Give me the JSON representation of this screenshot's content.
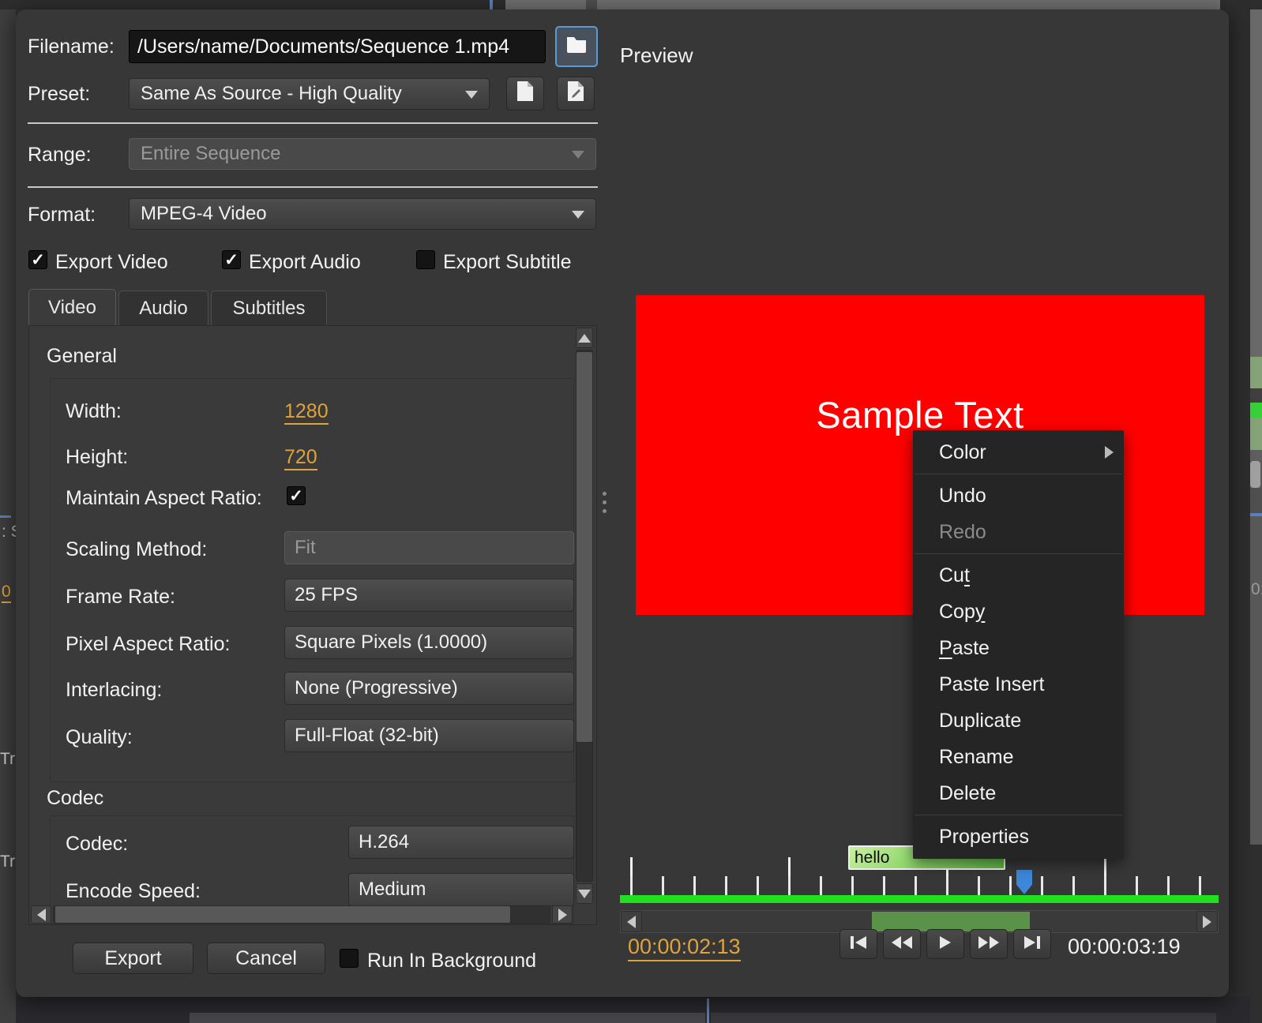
{
  "glyphs": {
    "check": "✓"
  },
  "colors": {
    "accent_orange": "#dfa33b",
    "timeline_green": "#20e020",
    "scroll_thumb_green": "#5b9249",
    "clip_green_light": "#c9ef9f",
    "clip_green_dark": "#5fb843",
    "playhead_blue": "#3d87d8",
    "focus_blue": "#5b9bd5",
    "preview_red": "#fe0000",
    "dialog_bg": "#373737"
  },
  "export_dialog": {
    "filename": {
      "label": "Filename:",
      "value": "/Users/name/Documents/Sequence 1.mp4"
    },
    "preset": {
      "label": "Preset:",
      "value": "Same As Source - High Quality"
    },
    "range": {
      "label": "Range:",
      "value": "Entire Sequence"
    },
    "format": {
      "label": "Format:",
      "value": "MPEG-4 Video"
    },
    "export_checks": [
      {
        "label": "Export Video",
        "checked": true
      },
      {
        "label": "Export Audio",
        "checked": true
      },
      {
        "label": "Export Subtitle",
        "checked": false
      }
    ],
    "tabs": [
      {
        "label": "Video"
      },
      {
        "label": "Audio"
      },
      {
        "label": "Subtitles"
      }
    ],
    "general": {
      "title": "General",
      "width_label": "Width:",
      "width_value": "1280",
      "height_label": "Height:",
      "height_value": "720",
      "mar_label": "Maintain Aspect Ratio:",
      "scaling_label": "Scaling Method:",
      "scaling_value": "Fit",
      "framerate_label": "Frame Rate:",
      "framerate_value": "25 FPS",
      "par_label": "Pixel Aspect Ratio:",
      "par_value": "Square Pixels (1.0000)",
      "interlacing_label": "Interlacing:",
      "interlacing_value": "None (Progressive)",
      "quality_label": "Quality:",
      "quality_value": "Full-Float (32-bit)"
    },
    "codec": {
      "title": "Codec",
      "codec_label": "Codec:",
      "codec_value": "H.264",
      "speed_label": "Encode Speed:",
      "speed_value": "Medium"
    },
    "footer": {
      "export": "Export",
      "cancel": "Cancel",
      "run_bg": "Run In Background"
    }
  },
  "preview": {
    "title": "Preview",
    "sample_text": "Sample Text",
    "clip_label": "hello",
    "current_time": "00:00:02:13",
    "total_time": "00:00:03:19"
  },
  "context_menu": {
    "items": [
      {
        "label": "Color",
        "submenu": true
      },
      {
        "label": "Undo"
      },
      {
        "label": "Redo",
        "disabled": true
      },
      {
        "label": "Cut",
        "mnemonic": "t"
      },
      {
        "label": "Copy",
        "mnemonic": "y"
      },
      {
        "label": "Paste",
        "mnemonic": "P"
      },
      {
        "label": "Paste Insert"
      },
      {
        "label": "Duplicate"
      },
      {
        "label": "Rename"
      },
      {
        "label": "Delete"
      },
      {
        "label": "Properties"
      }
    ]
  },
  "background": {
    "left_fragments": [
      ": S",
      "0",
      "Tr",
      "Tr"
    ],
    "right_fragment": "0:"
  }
}
